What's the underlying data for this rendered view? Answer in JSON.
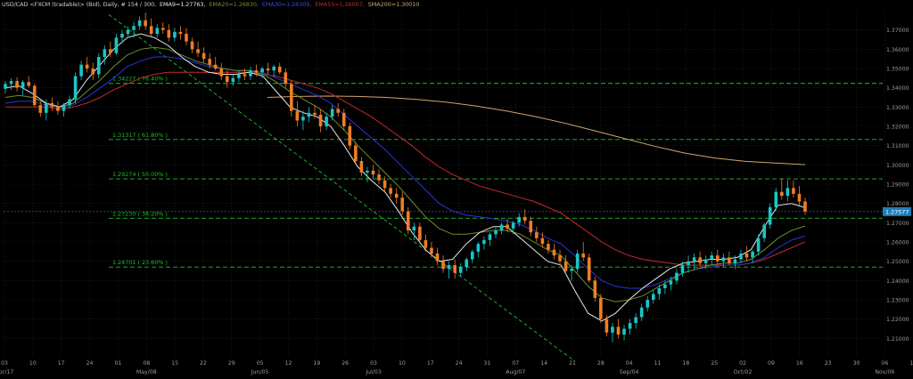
{
  "header": {
    "symbol": "USD/CAD <FXCM (tradable)> (Bid), Daily, # 154 / 300,",
    "ema9": "EMA9=1.27763,",
    "ema20": "EMA20=1.26830,",
    "ema30": "EMA30=1.26309,",
    "ema55": "EMA55=1.26007,",
    "sma200": "SMA200=1.30010"
  },
  "colors": {
    "background": "#000000",
    "grid": "#2a2a2a",
    "axis_text": "#9a9a9a",
    "bull": "#19c6c6",
    "bear": "#f07d24",
    "ema9": "#e8e8e8",
    "ema20": "#6f8f2a",
    "ema30": "#2a36d8",
    "ema55": "#c42a2a",
    "sma200": "#d4a36a",
    "fib": "#1fbf2e",
    "price_label_bg": "#1e7fb8",
    "header_symbol": "#cfcfcf"
  },
  "chart_data": {
    "type": "candlestick",
    "ylim": [
      1.2,
      1.38
    ],
    "yticks": [
      "1.37000",
      "1.36000",
      "1.35000",
      "1.34000",
      "1.33000",
      "1.32000",
      "1.31000",
      "1.30000",
      "1.29000",
      "1.28000",
      "1.27000",
      "1.26000",
      "1.25000",
      "1.24000",
      "1.23000",
      "1.22000",
      "1.21000"
    ],
    "xticks": [
      "03",
      "10",
      "17",
      "24",
      "01",
      "08",
      "15",
      "22",
      "29",
      "05",
      "12",
      "19",
      "26",
      "03",
      "10",
      "17",
      "24",
      "31",
      "07",
      "14",
      "21",
      "28",
      "04",
      "11",
      "18",
      "25",
      "02",
      "09",
      "16",
      "23",
      "30",
      "06",
      "13",
      "20"
    ],
    "month_labels": [
      "Apr/17",
      "May/08",
      "Jun/05",
      "Jul/03",
      "Aug/07",
      "Sep/04",
      "Oct/02",
      "Nov/06"
    ],
    "last_price": "1.27577",
    "fib_levels": [
      {
        "value": 1.34227,
        "label": "1.34227 ( 76.40% )"
      },
      {
        "value": 1.31317,
        "label": "1.31317 ( 61.80% )"
      },
      {
        "value": 1.29274,
        "label": "1.29274 ( 50.00% )"
      },
      {
        "value": 1.2723,
        "label": "1.27230 ( 38.20% )"
      },
      {
        "value": 1.24701,
        "label": "1.24701 ( 23.60% )"
      }
    ],
    "candles": [
      [
        1.3395,
        1.3435,
        1.337,
        1.342
      ],
      [
        1.342,
        1.345,
        1.339,
        1.3435
      ],
      [
        1.3435,
        1.3455,
        1.338,
        1.34
      ],
      [
        1.34,
        1.344,
        1.336,
        1.343
      ],
      [
        1.343,
        1.346,
        1.34,
        1.341
      ],
      [
        1.341,
        1.342,
        1.33,
        1.331
      ],
      [
        1.331,
        1.333,
        1.325,
        1.327
      ],
      [
        1.327,
        1.334,
        1.323,
        1.332
      ],
      [
        1.332,
        1.335,
        1.328,
        1.33
      ],
      [
        1.33,
        1.333,
        1.326,
        1.328
      ],
      [
        1.328,
        1.332,
        1.325,
        1.331
      ],
      [
        1.331,
        1.336,
        1.329,
        1.334
      ],
      [
        1.334,
        1.348,
        1.332,
        1.346
      ],
      [
        1.346,
        1.354,
        1.344,
        1.352
      ],
      [
        1.352,
        1.356,
        1.348,
        1.35
      ],
      [
        1.35,
        1.353,
        1.344,
        1.347
      ],
      [
        1.347,
        1.358,
        1.345,
        1.356
      ],
      [
        1.356,
        1.362,
        1.352,
        1.36
      ],
      [
        1.36,
        1.364,
        1.356,
        1.358
      ],
      [
        1.358,
        1.368,
        1.357,
        1.366
      ],
      [
        1.366,
        1.37,
        1.363,
        1.368
      ],
      [
        1.368,
        1.372,
        1.366,
        1.37
      ],
      [
        1.37,
        1.374,
        1.366,
        1.372
      ],
      [
        1.372,
        1.377,
        1.37,
        1.375
      ],
      [
        1.375,
        1.379,
        1.37,
        1.372
      ],
      [
        1.372,
        1.376,
        1.366,
        1.368
      ],
      [
        1.368,
        1.373,
        1.366,
        1.371
      ],
      [
        1.371,
        1.374,
        1.368,
        1.37
      ],
      [
        1.37,
        1.373,
        1.364,
        1.366
      ],
      [
        1.366,
        1.371,
        1.364,
        1.369
      ],
      [
        1.369,
        1.372,
        1.365,
        1.368
      ],
      [
        1.368,
        1.371,
        1.362,
        1.364
      ],
      [
        1.364,
        1.366,
        1.358,
        1.36
      ],
      [
        1.36,
        1.364,
        1.356,
        1.358
      ],
      [
        1.358,
        1.361,
        1.353,
        1.355
      ],
      [
        1.355,
        1.358,
        1.35,
        1.352
      ],
      [
        1.352,
        1.356,
        1.349,
        1.35
      ],
      [
        1.35,
        1.353,
        1.344,
        1.346
      ],
      [
        1.346,
        1.349,
        1.34,
        1.343
      ],
      [
        1.343,
        1.347,
        1.341,
        1.345
      ],
      [
        1.345,
        1.349,
        1.343,
        1.347
      ],
      [
        1.347,
        1.35,
        1.344,
        1.346
      ],
      [
        1.346,
        1.351,
        1.344,
        1.349
      ],
      [
        1.349,
        1.352,
        1.346,
        1.348
      ],
      [
        1.348,
        1.351,
        1.345,
        1.35
      ],
      [
        1.35,
        1.353,
        1.347,
        1.349
      ],
      [
        1.349,
        1.352,
        1.346,
        1.351
      ],
      [
        1.351,
        1.353,
        1.347,
        1.348
      ],
      [
        1.348,
        1.35,
        1.34,
        1.342
      ],
      [
        1.342,
        1.344,
        1.325,
        1.328
      ],
      [
        1.328,
        1.333,
        1.32,
        1.323
      ],
      [
        1.323,
        1.328,
        1.318,
        1.325
      ],
      [
        1.325,
        1.33,
        1.322,
        1.327
      ],
      [
        1.327,
        1.331,
        1.324,
        1.326
      ],
      [
        1.326,
        1.329,
        1.317,
        1.32
      ],
      [
        1.32,
        1.327,
        1.318,
        1.325
      ],
      [
        1.325,
        1.331,
        1.323,
        1.329
      ],
      [
        1.329,
        1.332,
        1.325,
        1.327
      ],
      [
        1.327,
        1.329,
        1.318,
        1.32
      ],
      [
        1.32,
        1.322,
        1.308,
        1.31
      ],
      [
        1.31,
        1.312,
        1.3,
        1.302
      ],
      [
        1.302,
        1.304,
        1.294,
        1.296
      ],
      [
        1.296,
        1.299,
        1.291,
        1.297
      ],
      [
        1.297,
        1.3,
        1.293,
        1.295
      ],
      [
        1.295,
        1.298,
        1.29,
        1.292
      ],
      [
        1.292,
        1.294,
        1.286,
        1.288
      ],
      [
        1.288,
        1.29,
        1.283,
        1.285
      ],
      [
        1.285,
        1.288,
        1.28,
        1.283
      ],
      [
        1.283,
        1.286,
        1.274,
        1.276
      ],
      [
        1.276,
        1.278,
        1.264,
        1.266
      ],
      [
        1.266,
        1.27,
        1.261,
        1.268
      ],
      [
        1.268,
        1.27,
        1.259,
        1.261
      ],
      [
        1.261,
        1.264,
        1.255,
        1.257
      ],
      [
        1.257,
        1.26,
        1.252,
        1.254
      ],
      [
        1.254,
        1.257,
        1.248,
        1.25
      ],
      [
        1.25,
        1.253,
        1.244,
        1.246
      ],
      [
        1.246,
        1.25,
        1.241,
        1.248
      ],
      [
        1.248,
        1.251,
        1.241,
        1.244
      ],
      [
        1.244,
        1.249,
        1.242,
        1.247
      ],
      [
        1.247,
        1.252,
        1.245,
        1.251
      ],
      [
        1.251,
        1.256,
        1.249,
        1.255
      ],
      [
        1.255,
        1.26,
        1.252,
        1.259
      ],
      [
        1.259,
        1.263,
        1.256,
        1.261
      ],
      [
        1.261,
        1.265,
        1.258,
        1.264
      ],
      [
        1.264,
        1.268,
        1.262,
        1.266
      ],
      [
        1.266,
        1.27,
        1.264,
        1.269
      ],
      [
        1.269,
        1.272,
        1.265,
        1.267
      ],
      [
        1.267,
        1.271,
        1.264,
        1.27
      ],
      [
        1.27,
        1.275,
        1.268,
        1.273
      ],
      [
        1.273,
        1.277,
        1.269,
        1.271
      ],
      [
        1.271,
        1.273,
        1.263,
        1.265
      ],
      [
        1.265,
        1.268,
        1.26,
        1.262
      ],
      [
        1.262,
        1.265,
        1.257,
        1.259
      ],
      [
        1.259,
        1.261,
        1.254,
        1.256
      ],
      [
        1.256,
        1.259,
        1.251,
        1.253
      ],
      [
        1.253,
        1.256,
        1.248,
        1.25
      ],
      [
        1.25,
        1.253,
        1.243,
        1.245
      ],
      [
        1.245,
        1.248,
        1.24,
        1.246
      ],
      [
        1.246,
        1.256,
        1.244,
        1.254
      ],
      [
        1.254,
        1.26,
        1.25,
        1.252
      ],
      [
        1.252,
        1.254,
        1.239,
        1.24
      ],
      [
        1.24,
        1.242,
        1.229,
        1.231
      ],
      [
        1.231,
        1.233,
        1.218,
        1.22
      ],
      [
        1.22,
        1.222,
        1.211,
        1.213
      ],
      [
        1.213,
        1.218,
        1.208,
        1.216
      ],
      [
        1.216,
        1.22,
        1.21,
        1.212
      ],
      [
        1.212,
        1.217,
        1.209,
        1.215
      ],
      [
        1.215,
        1.22,
        1.212,
        1.218
      ],
      [
        1.218,
        1.223,
        1.215,
        1.221
      ],
      [
        1.221,
        1.228,
        1.219,
        1.226
      ],
      [
        1.226,
        1.232,
        1.224,
        1.23
      ],
      [
        1.23,
        1.235,
        1.228,
        1.233
      ],
      [
        1.233,
        1.238,
        1.23,
        1.236
      ],
      [
        1.236,
        1.24,
        1.233,
        1.238
      ],
      [
        1.238,
        1.242,
        1.235,
        1.24
      ],
      [
        1.24,
        1.246,
        1.238,
        1.244
      ],
      [
        1.244,
        1.25,
        1.242,
        1.248
      ],
      [
        1.248,
        1.253,
        1.244,
        1.25
      ],
      [
        1.25,
        1.254,
        1.246,
        1.252
      ],
      [
        1.252,
        1.255,
        1.247,
        1.249
      ],
      [
        1.249,
        1.253,
        1.246,
        1.251
      ],
      [
        1.251,
        1.255,
        1.248,
        1.253
      ],
      [
        1.253,
        1.256,
        1.249,
        1.25
      ],
      [
        1.25,
        1.254,
        1.247,
        1.252
      ],
      [
        1.252,
        1.255,
        1.248,
        1.249
      ],
      [
        1.249,
        1.253,
        1.246,
        1.251
      ],
      [
        1.251,
        1.256,
        1.249,
        1.254
      ],
      [
        1.254,
        1.258,
        1.25,
        1.252
      ],
      [
        1.252,
        1.256,
        1.249,
        1.255
      ],
      [
        1.255,
        1.264,
        1.253,
        1.262
      ],
      [
        1.262,
        1.27,
        1.26,
        1.269
      ],
      [
        1.269,
        1.28,
        1.267,
        1.278
      ],
      [
        1.278,
        1.288,
        1.276,
        1.286
      ],
      [
        1.286,
        1.293,
        1.282,
        1.284
      ],
      [
        1.284,
        1.292,
        1.281,
        1.288
      ],
      [
        1.288,
        1.292,
        1.283,
        1.285
      ],
      [
        1.285,
        1.289,
        1.279,
        1.281
      ],
      [
        1.281,
        1.283,
        1.274,
        1.2758
      ]
    ],
    "ema9": [
      1.34,
      1.341,
      1.337,
      1.332,
      1.33,
      1.334,
      1.344,
      1.352,
      1.36,
      1.366,
      1.368,
      1.366,
      1.362,
      1.356,
      1.351,
      1.348,
      1.347,
      1.347,
      1.348,
      1.346,
      1.338,
      1.33,
      1.327,
      1.325,
      1.32,
      1.31,
      1.299,
      1.292,
      1.286,
      1.276,
      1.265,
      1.256,
      1.25,
      1.251,
      1.259,
      1.265,
      1.268,
      1.268,
      1.262,
      1.256,
      1.25,
      1.248,
      1.235,
      1.223,
      1.219,
      1.223,
      1.23,
      1.236,
      1.241,
      1.246,
      1.249,
      1.25,
      1.251,
      1.251,
      1.252,
      1.256,
      1.268,
      1.279,
      1.28,
      1.2778
    ],
    "ema20": [
      1.335,
      1.336,
      1.335,
      1.332,
      1.33,
      1.332,
      1.338,
      1.344,
      1.351,
      1.357,
      1.36,
      1.361,
      1.36,
      1.357,
      1.354,
      1.352,
      1.35,
      1.349,
      1.349,
      1.347,
      1.343,
      1.338,
      1.334,
      1.33,
      1.325,
      1.318,
      1.31,
      1.303,
      1.296,
      1.289,
      1.281,
      1.273,
      1.267,
      1.264,
      1.264,
      1.265,
      1.266,
      1.266,
      1.264,
      1.26,
      1.256,
      1.253,
      1.245,
      1.237,
      1.231,
      1.229,
      1.23,
      1.232,
      1.236,
      1.24,
      1.244,
      1.246,
      1.248,
      1.249,
      1.249,
      1.251,
      1.256,
      1.262,
      1.266,
      1.2683
    ],
    "ema30": [
      1.332,
      1.333,
      1.333,
      1.331,
      1.33,
      1.331,
      1.335,
      1.34,
      1.345,
      1.351,
      1.354,
      1.356,
      1.356,
      1.355,
      1.353,
      1.351,
      1.35,
      1.349,
      1.349,
      1.348,
      1.345,
      1.342,
      1.339,
      1.336,
      1.332,
      1.326,
      1.32,
      1.314,
      1.308,
      1.301,
      1.294,
      1.287,
      1.28,
      1.276,
      1.274,
      1.273,
      1.272,
      1.271,
      1.269,
      1.266,
      1.262,
      1.259,
      1.253,
      1.246,
      1.24,
      1.237,
      1.236,
      1.236,
      1.238,
      1.241,
      1.244,
      1.246,
      1.247,
      1.248,
      1.248,
      1.249,
      1.252,
      1.257,
      1.261,
      1.2631
    ],
    "ema55": [
      1.33,
      1.33,
      1.33,
      1.33,
      1.329,
      1.33,
      1.332,
      1.335,
      1.339,
      1.342,
      1.345,
      1.347,
      1.348,
      1.348,
      1.348,
      1.348,
      1.348,
      1.348,
      1.348,
      1.347,
      1.346,
      1.344,
      1.342,
      1.34,
      1.337,
      1.333,
      1.329,
      1.325,
      1.32,
      1.315,
      1.31,
      1.304,
      1.299,
      1.295,
      1.292,
      1.289,
      1.287,
      1.285,
      1.283,
      1.281,
      1.278,
      1.275,
      1.27,
      1.265,
      1.26,
      1.256,
      1.253,
      1.251,
      1.25,
      1.249,
      1.248,
      1.248,
      1.248,
      1.248,
      1.248,
      1.249,
      1.251,
      1.254,
      1.257,
      1.2601
    ],
    "sma200": [
      1.335,
      1.3355,
      1.3357,
      1.3355,
      1.335,
      1.334,
      1.3325,
      1.3305,
      1.328,
      1.325,
      1.3215,
      1.3175,
      1.3135,
      1.3095,
      1.306,
      1.3035,
      1.3018,
      1.301,
      1.3001
    ]
  }
}
